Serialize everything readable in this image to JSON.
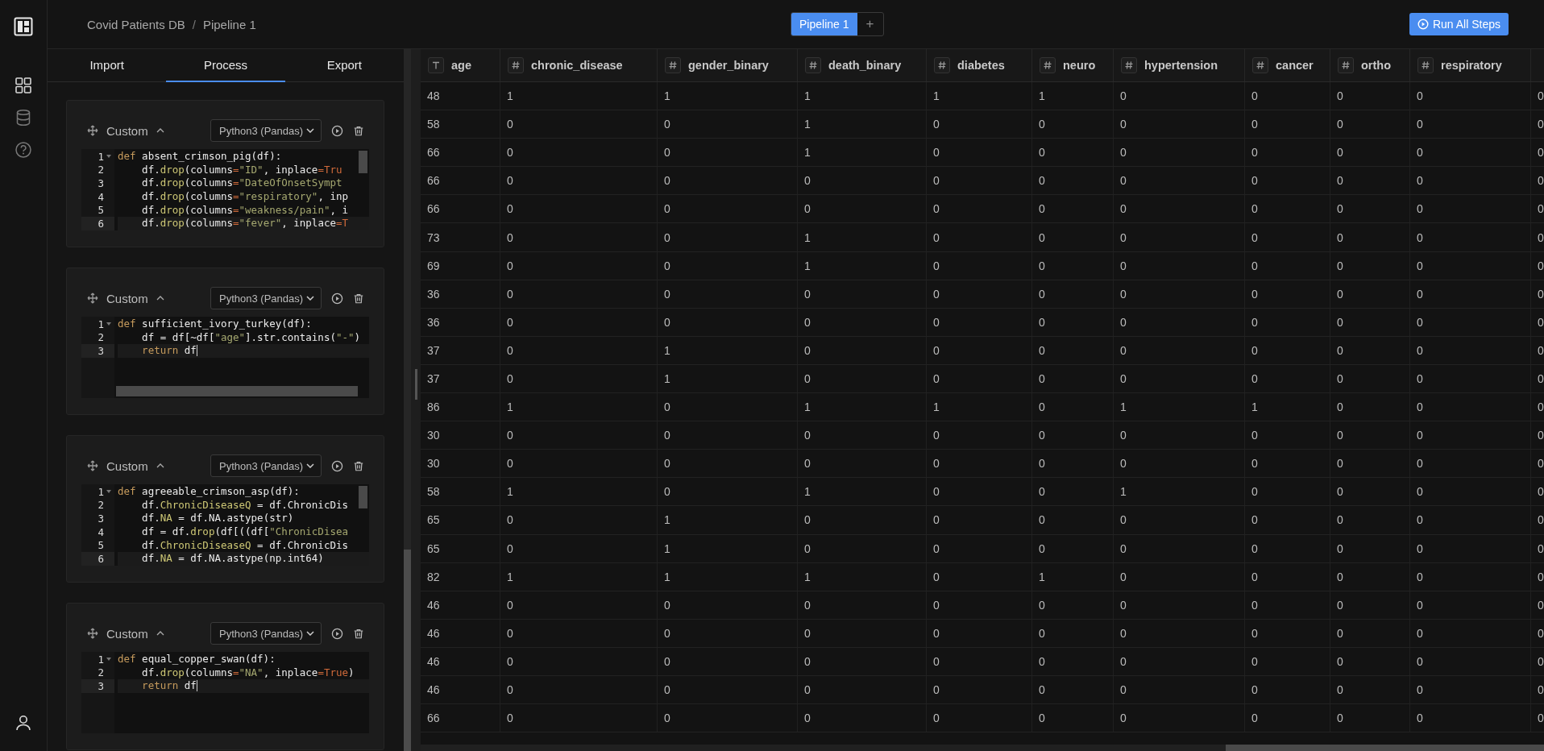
{
  "nav": [
    {
      "kind": "grid",
      "selected": true
    },
    {
      "kind": "database",
      "selected": false
    },
    {
      "kind": "help",
      "selected": false
    }
  ],
  "breadcrumb": [
    "Covid Patients DB",
    "Pipeline 1"
  ],
  "breadcrumb_separator": "/",
  "pipeline_tabs": [
    {
      "label": "Pipeline 1",
      "selected": true
    }
  ],
  "add_pipeline": "+",
  "run_button": "Run All Steps",
  "panel_tabs": [
    {
      "label": "Import",
      "selected": false
    },
    {
      "label": "Process",
      "selected": true
    },
    {
      "label": "Export",
      "selected": false
    }
  ],
  "steps": [
    {
      "title": "Custom",
      "expanded": true,
      "language": "Python3 (Pandas)",
      "scrollbar_vertical": true,
      "scrollbar_horizontal": false,
      "lines": [
        {
          "number": "1",
          "active": false,
          "tokens": [
            {
              "kind": "keyword",
              "text": "def"
            },
            {
              "kind": "plain",
              "text": " absent_crimson_pig(df):"
            }
          ]
        },
        {
          "number": "2",
          "active": false,
          "tokens": [
            {
              "kind": "plain",
              "text": "    df."
            },
            {
              "kind": "method",
              "text": "drop"
            },
            {
              "kind": "plain",
              "text": "(columns"
            },
            {
              "kind": "constant",
              "text": "="
            },
            {
              "kind": "string",
              "text": "\"ID\""
            },
            {
              "kind": "plain",
              "text": ", inplace"
            },
            {
              "kind": "constant",
              "text": "=Tru"
            }
          ]
        },
        {
          "number": "3",
          "active": false,
          "tokens": [
            {
              "kind": "plain",
              "text": "    df."
            },
            {
              "kind": "method",
              "text": "drop"
            },
            {
              "kind": "plain",
              "text": "(columns"
            },
            {
              "kind": "constant",
              "text": "="
            },
            {
              "kind": "string",
              "text": "\"DateOfOnsetSympt"
            }
          ]
        },
        {
          "number": "4",
          "active": false,
          "tokens": [
            {
              "kind": "plain",
              "text": "    df."
            },
            {
              "kind": "method",
              "text": "drop"
            },
            {
              "kind": "plain",
              "text": "(columns"
            },
            {
              "kind": "constant",
              "text": "="
            },
            {
              "kind": "string",
              "text": "\"respiratory\""
            },
            {
              "kind": "plain",
              "text": ", inp"
            }
          ]
        },
        {
          "number": "5",
          "active": false,
          "tokens": [
            {
              "kind": "plain",
              "text": "    df."
            },
            {
              "kind": "method",
              "text": "drop"
            },
            {
              "kind": "plain",
              "text": "(columns"
            },
            {
              "kind": "constant",
              "text": "="
            },
            {
              "kind": "string",
              "text": "\"weakness/pain\""
            },
            {
              "kind": "plain",
              "text": ", i"
            }
          ]
        },
        {
          "number": "6",
          "active": true,
          "tokens": [
            {
              "kind": "plain",
              "text": "    df."
            },
            {
              "kind": "method",
              "text": "drop"
            },
            {
              "kind": "plain",
              "text": "(columns"
            },
            {
              "kind": "constant",
              "text": "="
            },
            {
              "kind": "string",
              "text": "\"fever\""
            },
            {
              "kind": "plain",
              "text": ", inplace"
            },
            {
              "kind": "constant",
              "text": "=T"
            }
          ]
        }
      ]
    },
    {
      "title": "Custom",
      "expanded": true,
      "language": "Python3 (Pandas)",
      "scrollbar_vertical": false,
      "scrollbar_horizontal": true,
      "lines": [
        {
          "number": "1",
          "active": false,
          "tokens": [
            {
              "kind": "keyword",
              "text": "def"
            },
            {
              "kind": "plain",
              "text": " sufficient_ivory_turkey(df):"
            }
          ]
        },
        {
          "number": "2",
          "active": false,
          "tokens": [
            {
              "kind": "plain",
              "text": "    df = df[~df["
            },
            {
              "kind": "string",
              "text": "\"age\""
            },
            {
              "kind": "plain",
              "text": "].str.contains("
            },
            {
              "kind": "string",
              "text": "\"-\""
            },
            {
              "kind": "plain",
              "text": ")"
            }
          ]
        },
        {
          "number": "3",
          "active": true,
          "tokens": [
            {
              "kind": "keyword",
              "text": "    return"
            },
            {
              "kind": "plain",
              "text": " df"
            }
          ]
        }
      ]
    },
    {
      "title": "Custom",
      "expanded": true,
      "language": "Python3 (Pandas)",
      "scrollbar_vertical": true,
      "scrollbar_horizontal": false,
      "lines": [
        {
          "number": "1",
          "active": false,
          "tokens": [
            {
              "kind": "keyword",
              "text": "def"
            },
            {
              "kind": "plain",
              "text": " agreeable_crimson_asp(df):"
            }
          ]
        },
        {
          "number": "2",
          "active": false,
          "tokens": [
            {
              "kind": "plain",
              "text": "    df."
            },
            {
              "kind": "method",
              "text": "ChronicDiseaseQ"
            },
            {
              "kind": "plain",
              "text": " = df.ChronicDis"
            }
          ]
        },
        {
          "number": "3",
          "active": false,
          "tokens": [
            {
              "kind": "plain",
              "text": "    df."
            },
            {
              "kind": "method",
              "text": "NA"
            },
            {
              "kind": "plain",
              "text": " = df.NA.astype(str)"
            }
          ]
        },
        {
          "number": "4",
          "active": false,
          "tokens": [
            {
              "kind": "plain",
              "text": "    df = df."
            },
            {
              "kind": "method",
              "text": "drop"
            },
            {
              "kind": "plain",
              "text": "(df[((df["
            },
            {
              "kind": "string",
              "text": "\"ChronicDisea"
            }
          ]
        },
        {
          "number": "5",
          "active": false,
          "tokens": [
            {
              "kind": "plain",
              "text": "    df."
            },
            {
              "kind": "method",
              "text": "ChronicDiseaseQ"
            },
            {
              "kind": "plain",
              "text": " = df.ChronicDis"
            }
          ]
        },
        {
          "number": "6",
          "active": true,
          "tokens": [
            {
              "kind": "plain",
              "text": "    df."
            },
            {
              "kind": "method",
              "text": "NA"
            },
            {
              "kind": "plain",
              "text": " = df.NA.astype(np.int64)"
            }
          ]
        }
      ]
    },
    {
      "title": "Custom",
      "expanded": true,
      "language": "Python3 (Pandas)",
      "scrollbar_vertical": false,
      "scrollbar_horizontal": false,
      "lines": [
        {
          "number": "1",
          "active": false,
          "tokens": [
            {
              "kind": "keyword",
              "text": "def"
            },
            {
              "kind": "plain",
              "text": " equal_copper_swan(df):"
            }
          ]
        },
        {
          "number": "2",
          "active": false,
          "tokens": [
            {
              "kind": "plain",
              "text": "    df."
            },
            {
              "kind": "method",
              "text": "drop"
            },
            {
              "kind": "plain",
              "text": "(columns"
            },
            {
              "kind": "constant",
              "text": "="
            },
            {
              "kind": "string",
              "text": "\"NA\""
            },
            {
              "kind": "plain",
              "text": ", inplace"
            },
            {
              "kind": "constant",
              "text": "=True"
            },
            {
              "kind": "plain",
              "text": ")"
            }
          ]
        },
        {
          "number": "3",
          "active": true,
          "tokens": [
            {
              "kind": "keyword",
              "text": "    return"
            },
            {
              "kind": "plain",
              "text": " df"
            }
          ]
        }
      ]
    }
  ],
  "table": {
    "columns": [
      {
        "name": "age",
        "kind": "text"
      },
      {
        "name": "chronic_disease",
        "kind": "number"
      },
      {
        "name": "gender_binary",
        "kind": "number"
      },
      {
        "name": "death_binary",
        "kind": "number"
      },
      {
        "name": "diabetes",
        "kind": "number"
      },
      {
        "name": "neuro",
        "kind": "number"
      },
      {
        "name": "hypertension",
        "kind": "number"
      },
      {
        "name": "cancer",
        "kind": "number"
      },
      {
        "name": "ortho",
        "kind": "number"
      },
      {
        "name": "respiratory",
        "kind": "number"
      },
      {
        "kind": "cut"
      }
    ],
    "rows": [
      [
        "48",
        "1",
        "1",
        "1",
        "1",
        "1",
        "0",
        "0",
        "0",
        "0",
        "0"
      ],
      [
        "58",
        "0",
        "0",
        "1",
        "0",
        "0",
        "0",
        "0",
        "0",
        "0",
        "0"
      ],
      [
        "66",
        "0",
        "0",
        "1",
        "0",
        "0",
        "0",
        "0",
        "0",
        "0",
        "0"
      ],
      [
        "66",
        "0",
        "0",
        "0",
        "0",
        "0",
        "0",
        "0",
        "0",
        "0",
        "0"
      ],
      [
        "66",
        "0",
        "0",
        "0",
        "0",
        "0",
        "0",
        "0",
        "0",
        "0",
        "0"
      ],
      [
        "73",
        "0",
        "0",
        "1",
        "0",
        "0",
        "0",
        "0",
        "0",
        "0",
        "0"
      ],
      [
        "69",
        "0",
        "0",
        "1",
        "0",
        "0",
        "0",
        "0",
        "0",
        "0",
        "0"
      ],
      [
        "36",
        "0",
        "0",
        "0",
        "0",
        "0",
        "0",
        "0",
        "0",
        "0",
        "0"
      ],
      [
        "36",
        "0",
        "0",
        "0",
        "0",
        "0",
        "0",
        "0",
        "0",
        "0",
        "0"
      ],
      [
        "37",
        "0",
        "1",
        "0",
        "0",
        "0",
        "0",
        "0",
        "0",
        "0",
        "0"
      ],
      [
        "37",
        "0",
        "1",
        "0",
        "0",
        "0",
        "0",
        "0",
        "0",
        "0",
        "0"
      ],
      [
        "86",
        "1",
        "0",
        "1",
        "1",
        "0",
        "1",
        "1",
        "0",
        "0",
        "0"
      ],
      [
        "30",
        "0",
        "0",
        "0",
        "0",
        "0",
        "0",
        "0",
        "0",
        "0",
        "0"
      ],
      [
        "30",
        "0",
        "0",
        "0",
        "0",
        "0",
        "0",
        "0",
        "0",
        "0",
        "0"
      ],
      [
        "58",
        "1",
        "0",
        "1",
        "0",
        "0",
        "1",
        "0",
        "0",
        "0",
        "0"
      ],
      [
        "65",
        "0",
        "1",
        "0",
        "0",
        "0",
        "0",
        "0",
        "0",
        "0",
        "0"
      ],
      [
        "65",
        "0",
        "1",
        "0",
        "0",
        "0",
        "0",
        "0",
        "0",
        "0",
        "0"
      ],
      [
        "82",
        "1",
        "1",
        "1",
        "0",
        "1",
        "0",
        "0",
        "0",
        "0",
        "0"
      ],
      [
        "46",
        "0",
        "0",
        "0",
        "0",
        "0",
        "0",
        "0",
        "0",
        "0",
        "0"
      ],
      [
        "46",
        "0",
        "0",
        "0",
        "0",
        "0",
        "0",
        "0",
        "0",
        "0",
        "0"
      ],
      [
        "46",
        "0",
        "0",
        "0",
        "0",
        "0",
        "0",
        "0",
        "0",
        "0",
        "0"
      ],
      [
        "46",
        "0",
        "0",
        "0",
        "0",
        "0",
        "0",
        "0",
        "0",
        "0",
        "0"
      ],
      [
        "66",
        "0",
        "0",
        "0",
        "0",
        "0",
        "0",
        "0",
        "0",
        "0",
        "0"
      ]
    ]
  }
}
